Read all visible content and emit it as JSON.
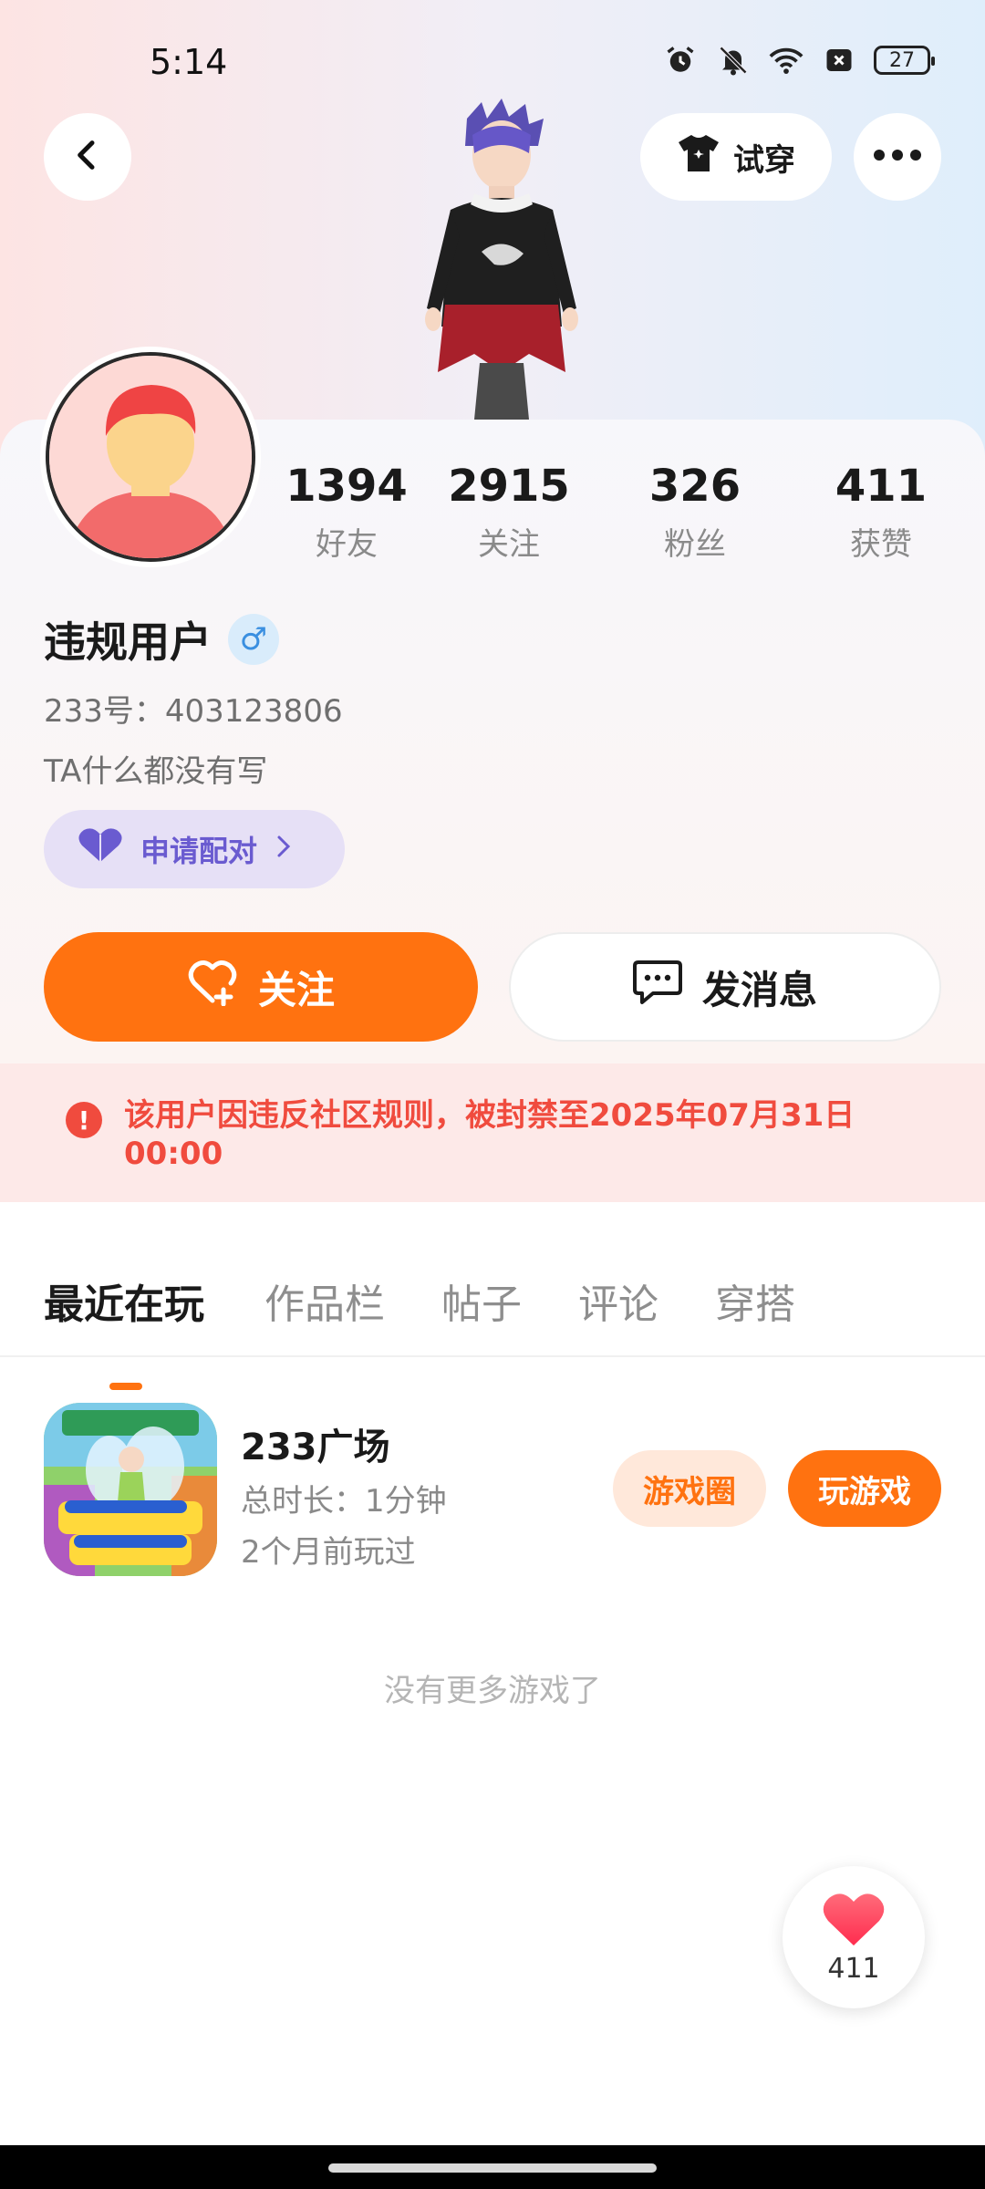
{
  "status": {
    "time": "5:14",
    "battery": "27",
    "icons": [
      "alarm-icon",
      "mute-icon",
      "wifi-icon",
      "no-sim-icon",
      "battery-icon"
    ]
  },
  "header": {
    "try_on_label": "试穿",
    "icons": [
      "back-icon",
      "shirt-icon",
      "more-icon"
    ]
  },
  "profile": {
    "stats": [
      {
        "value": "1394",
        "label": "好友"
      },
      {
        "value": "2915",
        "label": "关注"
      },
      {
        "value": "326",
        "label": "粉丝"
      },
      {
        "value": "411",
        "label": "获赞"
      }
    ],
    "name": "违规用户",
    "gender_symbol": "♂",
    "uid": "233号：403123806",
    "bio": "TA什么都没有写",
    "pair_label": "申请配对"
  },
  "actions": {
    "follow_label": "关注",
    "message_label": "发消息"
  },
  "ban": {
    "icon_glyph": "!",
    "text": "该用户因违反社区规则，被封禁至2025年07月31日 00:00"
  },
  "tabs": [
    {
      "label": "最近在玩",
      "active": true
    },
    {
      "label": "作品栏",
      "active": false
    },
    {
      "label": "帖子",
      "active": false
    },
    {
      "label": "评论",
      "active": false
    },
    {
      "label": "穿搭",
      "active": false
    }
  ],
  "games": [
    {
      "title": "233广场",
      "duration": "总时长：1分钟",
      "last_played": "2个月前玩过",
      "circle_label": "游戏圈",
      "play_label": "玩游戏"
    }
  ],
  "list_end_text": "没有更多游戏了",
  "like_fab": {
    "count": "411"
  },
  "colors": {
    "accent": "#ff7210",
    "ban_red": "#f04b3e",
    "pair_purple": "#6a5bd0"
  }
}
